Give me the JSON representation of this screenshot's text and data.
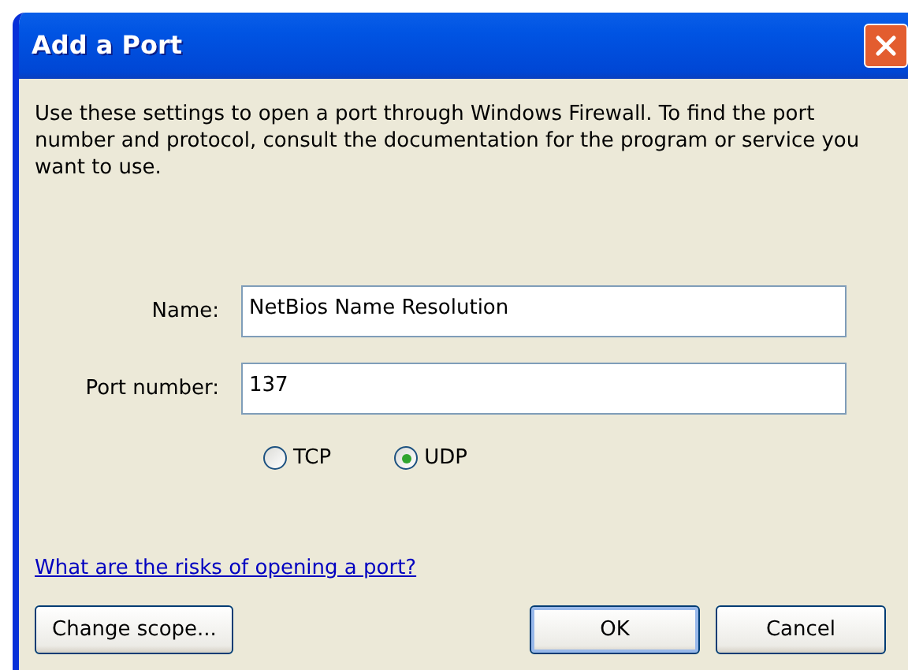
{
  "window": {
    "title": "Add a Port"
  },
  "intro": "Use these settings to open a port through Windows Firewall. To find the port number and protocol, consult the documentation for the program or service you want to use.",
  "fields": [
    {
      "label": "Name:",
      "value": "NetBios Name Resolution"
    },
    {
      "label": "Port number:",
      "value": "137"
    }
  ],
  "protocols": [
    {
      "label": "TCP",
      "selected": false
    },
    {
      "label": "UDP",
      "selected": true
    }
  ],
  "help_link": "What are the risks of opening a port?",
  "buttons": [
    {
      "label": "Change scope...",
      "default": false,
      "kind": "left"
    },
    {
      "label": "OK",
      "default": true,
      "kind": "right"
    },
    {
      "label": "Cancel",
      "default": false,
      "kind": "right"
    }
  ]
}
